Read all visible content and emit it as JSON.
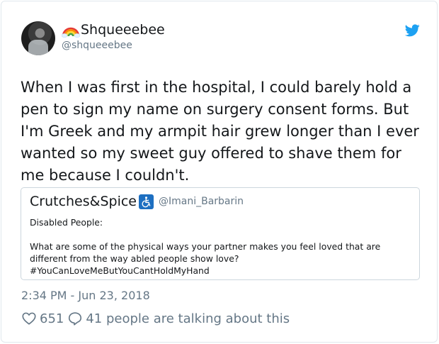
{
  "author": {
    "display_name": "Shqueeebee",
    "handle": "@shqueeebee",
    "name_emoji": "rainbow-icon"
  },
  "tweet": {
    "text": "When I was first in the hospital, I could barely hold a pen to sign my name on surgery consent forms. But I'm Greek and my armpit hair grew longer than I ever wanted so my sweet guy offered to shave them for me because I couldn't.",
    "timestamp": "2:34 PM - Jun 23, 2018"
  },
  "quoted_tweet": {
    "display_name": "Crutches&Spice",
    "name_emoji": "wheelchair-symbol-icon",
    "handle": "@Imani_Barbarin",
    "text": "Disabled People:\n\nWhat are some of the physical ways your partner makes you feel loved that are different from the way abled people show love?\n#YouCanLoveMeButYouCantHoldMyHand"
  },
  "engagement": {
    "likes": "651",
    "replies_text": "41 people are talking about this"
  },
  "colors": {
    "brand_blue": "#1da1f2",
    "secondary_text": "#657786",
    "border": "#e1e8ed"
  }
}
